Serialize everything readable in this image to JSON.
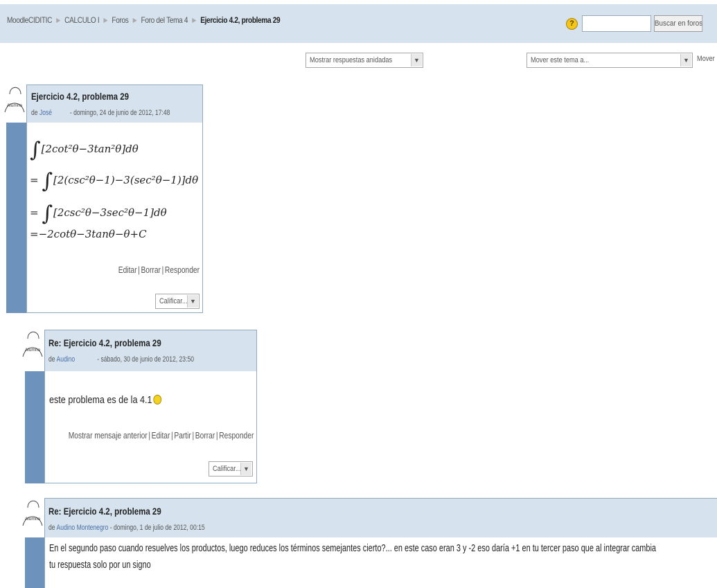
{
  "navbar": {
    "breadcrumb": [
      "MoodleCIDITIC",
      "CALCULO I",
      "Foros",
      "Foro del Tema 4"
    ],
    "current": "Ejercicio 4.2, problema 29",
    "help_icon": "?",
    "search_value": "",
    "search_button": "Buscar en foros"
  },
  "controls": {
    "display_mode": "Mostrar respuestas anidadas",
    "move_topic": "Mover este tema a...",
    "move_button": "Mover"
  },
  "posts": [
    {
      "avatar_label": "Alumno",
      "subject": "Ejercicio 4.2, problema 29",
      "by": "de",
      "author": "José",
      "date": "- domingo, 24 de junio de 2012, 17:48",
      "math": [
        "[2cot²θ−3tan²θ]dθ",
        "[2(csc²θ−1)−3(sec²θ−1)]dθ",
        "[2csc²θ−3sec²θ−1]dθ",
        "=−2cotθ−3tanθ−θ+C"
      ],
      "commands": [
        "Editar",
        "Borrar",
        "Responder"
      ],
      "rate": "Calificar..."
    },
    {
      "avatar_label": "Alumno",
      "subject": "Re: Ejercicio 4.2, problema 29",
      "by": "de",
      "author": "Audino",
      "date": "- sábado, 30 de junio de 2012, 23:50",
      "message": "este problema es de la 4.1",
      "commands": [
        "Mostrar mensaje anterior",
        "Editar",
        "Partir",
        "Borrar",
        "Responder"
      ],
      "rate": "Calificar..."
    },
    {
      "avatar_label": "Alumno",
      "subject": "Re: Ejercicio 4.2, problema 29",
      "by": "de",
      "author": "Audino Montenegro",
      "date": "- domingo, 1 de julio de 2012, 00:15",
      "message_line1": "En el segundo paso cuando resuelves los productos, luego reduces los términos semejantes cierto?... en este caso eran 3 y -2 eso daría +1 en tu tercer paso que al integrar cambia",
      "message_line2": "tu respuesta solo por un signo"
    }
  ],
  "colors": {
    "header_bg": "#d6e3ee",
    "side_bar": "#6d93bd",
    "border": "#8fa9c2",
    "link": "#4a6fa5"
  }
}
